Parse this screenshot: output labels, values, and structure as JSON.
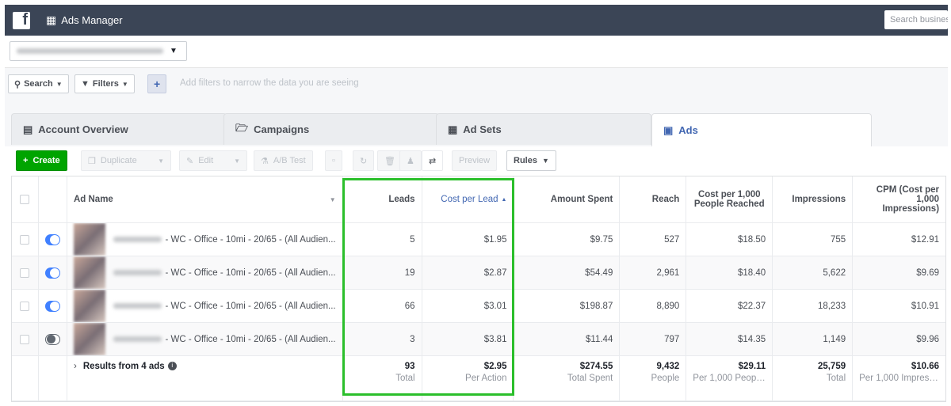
{
  "topbar": {
    "logo": "f",
    "app_name": "Ads Manager",
    "search_placeholder": "Search business"
  },
  "filters": {
    "search": "Search",
    "filters": "Filters",
    "plus": "+",
    "hint": "Add filters to narrow the data you are seeing"
  },
  "tabs": [
    {
      "label": "Account Overview",
      "icon": "account-overview-icon"
    },
    {
      "label": "Campaigns",
      "icon": "folder-icon"
    },
    {
      "label": "Ad Sets",
      "icon": "grid-icon"
    },
    {
      "label": "Ads",
      "icon": "ad-icon"
    }
  ],
  "toolbar": {
    "create": "Create",
    "duplicate": "Duplicate",
    "edit": "Edit",
    "ab_test": "A/B Test",
    "preview": "Preview",
    "rules": "Rules"
  },
  "columns": {
    "ad_name": "Ad Name",
    "leads": "Leads",
    "cpl": "Cost per Lead",
    "amount": "Amount Spent",
    "reach": "Reach",
    "cpr": "Cost per 1,000 People Reached",
    "impressions": "Impressions",
    "cpm": "CPM (Cost per 1,000 Impressions)"
  },
  "rows": [
    {
      "name": "- WC - Office - 10mi - 20/65 - (All Audien...",
      "on": true,
      "leads": "5",
      "cpl": "$1.95",
      "amount": "$9.75",
      "reach": "527",
      "cpr": "$18.50",
      "impressions": "755",
      "cpm": "$12.91"
    },
    {
      "name": "- WC - Office - 10mi - 20/65 - (All Audien...",
      "on": true,
      "leads": "19",
      "cpl": "$2.87",
      "amount": "$54.49",
      "reach": "2,961",
      "cpr": "$18.40",
      "impressions": "5,622",
      "cpm": "$9.69"
    },
    {
      "name": "- WC - Office - 10mi - 20/65 - (All Audien...",
      "on": true,
      "leads": "66",
      "cpl": "$3.01",
      "amount": "$198.87",
      "reach": "8,890",
      "cpr": "$22.37",
      "impressions": "18,233",
      "cpm": "$10.91"
    },
    {
      "name": "- WC - Office - 10mi - 20/65 - (All Audien...",
      "on": false,
      "leads": "3",
      "cpl": "$3.81",
      "amount": "$11.44",
      "reach": "797",
      "cpr": "$14.35",
      "impressions": "1,149",
      "cpm": "$9.96"
    }
  ],
  "footer": {
    "label": "Results from 4 ads",
    "leads": "93",
    "leads_sub": "Total",
    "cpl": "$2.95",
    "cpl_sub": "Per Action",
    "amount": "$274.55",
    "amount_sub": "Total Spent",
    "reach": "9,432",
    "reach_sub": "People",
    "cpr": "$29.11",
    "cpr_sub": "Per 1,000 People ...",
    "impressions": "25,759",
    "impressions_sub": "Total",
    "cpm": "$10.66",
    "cpm_sub": "Per 1,000 Impressi..."
  },
  "colors": {
    "highlight": "#2bbf2b",
    "accent": "#4267b2",
    "create": "#00a400"
  }
}
